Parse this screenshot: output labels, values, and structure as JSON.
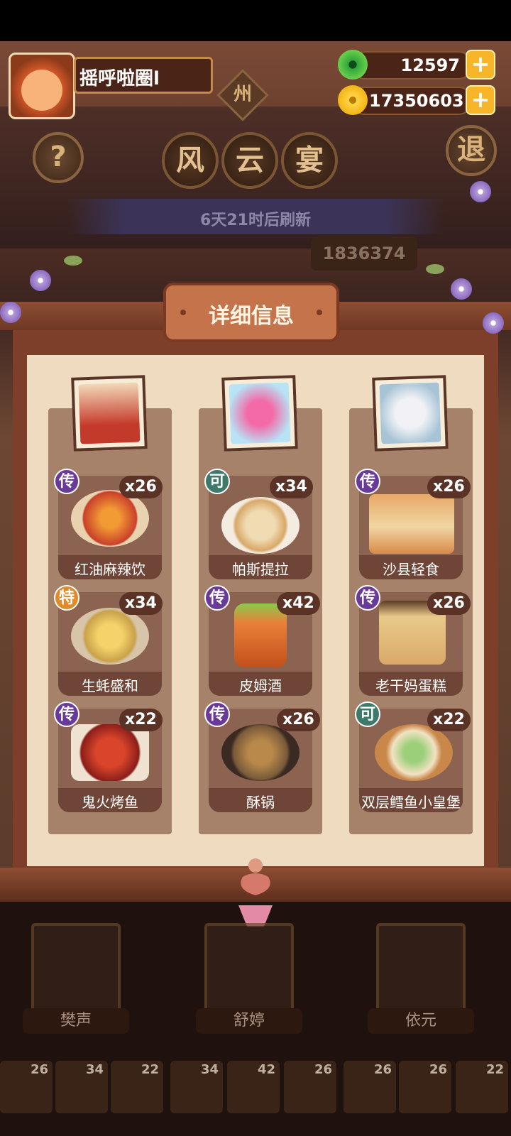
{
  "player": {
    "name": "摇呼啦圈l"
  },
  "currency": {
    "jade": "12597",
    "coins": "17350603"
  },
  "header": {
    "region": "州",
    "title_chars": [
      "风",
      "云",
      "宴"
    ],
    "help_label": "?",
    "exit_label": "退",
    "refresh": "6天21时后刷新",
    "score": "1836374"
  },
  "panel": {
    "title": "详细信息"
  },
  "columns": [
    {
      "dishes": [
        {
          "badge": "传",
          "badge_type": "chuan",
          "qty": "x26",
          "name": "红油麻辣饮"
        },
        {
          "badge": "特",
          "badge_type": "te",
          "qty": "x34",
          "name": "生蚝盛和"
        },
        {
          "badge": "传",
          "badge_type": "chuan",
          "qty": "x22",
          "name": "鬼火烤鱼"
        }
      ]
    },
    {
      "dishes": [
        {
          "badge": "可",
          "badge_type": "ke",
          "qty": "x34",
          "name": "帕斯提拉"
        },
        {
          "badge": "传",
          "badge_type": "chuan",
          "qty": "x42",
          "name": "皮姆酒"
        },
        {
          "badge": "传",
          "badge_type": "chuan",
          "qty": "x26",
          "name": "酥锅"
        }
      ]
    },
    {
      "dishes": [
        {
          "badge": "传",
          "badge_type": "chuan",
          "qty": "x26",
          "name": "沙县轻食"
        },
        {
          "badge": "传",
          "badge_type": "chuan",
          "qty": "x26",
          "name": "老干妈蛋糕"
        },
        {
          "badge": "可",
          "badge_type": "ke",
          "qty": "x22",
          "name": "双层鳕鱼小皇堡"
        }
      ]
    }
  ],
  "characters": [
    "樊声",
    "舒婷",
    "依元"
  ],
  "dish_strip": [
    "26",
    "34",
    "22",
    "34",
    "42",
    "26",
    "26",
    "26",
    "22"
  ],
  "colors": {
    "accent": "#f7b52a",
    "legend_badge": "#6a3a9a",
    "card": "#8c6250"
  }
}
